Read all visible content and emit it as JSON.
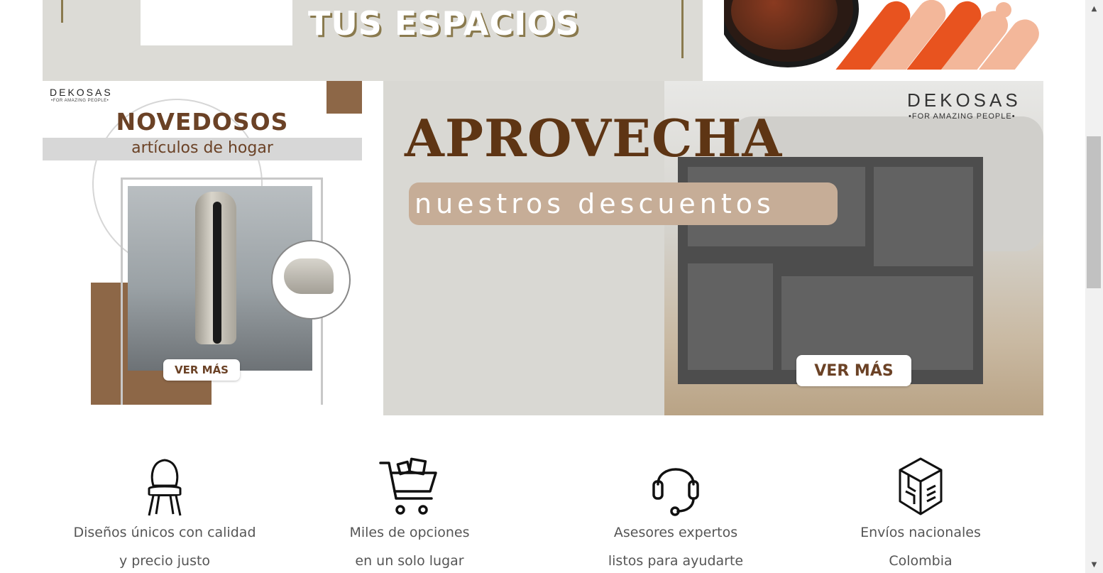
{
  "top_banner_left": {
    "headline": "TUS ESPACIOS"
  },
  "banner_novedosos": {
    "brand": "DEKOSAS",
    "tagline": "•FOR AMAZING PEOPLE•",
    "title": "NOVEDOSOS",
    "subtitle": "artículos de hogar",
    "button_label": "VER MÁS"
  },
  "banner_aprovecha": {
    "brand": "DEKOSAS",
    "tagline": "•FOR AMAZING PEOPLE•",
    "title": "APROVECHA",
    "subtitle": "nuestros descuentos",
    "button_label": "VER MÁS"
  },
  "features": [
    {
      "icon": "chair-icon",
      "line1": "Diseños únicos con calidad",
      "line2": "y precio justo"
    },
    {
      "icon": "shopping-cart-icon",
      "line1": "Miles de opciones",
      "line2": "en un solo lugar"
    },
    {
      "icon": "headset-icon",
      "line1": "Asesores expertos",
      "line2": "listos para ayudarte"
    },
    {
      "icon": "package-box-icon",
      "line1": "Envíos nacionales",
      "line2": "Colombia"
    }
  ],
  "colors": {
    "brand_brown": "#6b4226",
    "accent_tan": "#c6ad97",
    "banner_gray": "#d9d8d3",
    "orange": "#e8531f"
  }
}
